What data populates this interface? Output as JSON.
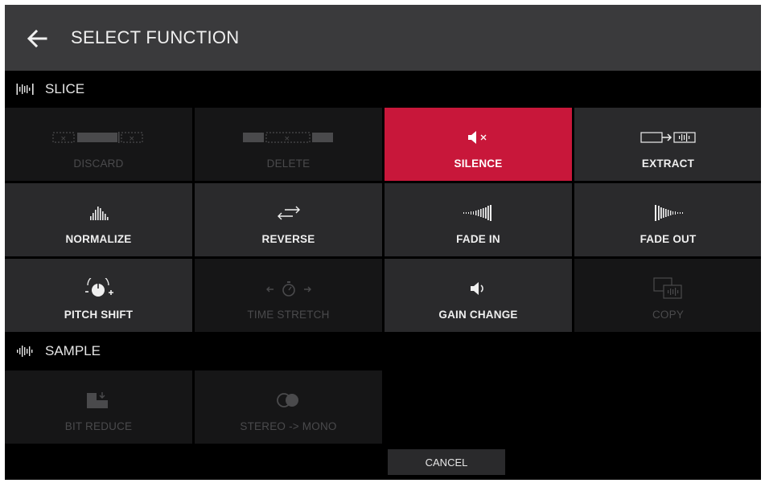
{
  "header": {
    "title": "SELECT FUNCTION",
    "back_icon": "arrow-left-icon"
  },
  "slice": {
    "label": "SLICE",
    "icon": "slice-waveform-icon",
    "tiles": [
      {
        "label": "DISCARD",
        "icon": "discard-icon",
        "state": "disabled"
      },
      {
        "label": "DELETE",
        "icon": "delete-icon",
        "state": "disabled"
      },
      {
        "label": "SILENCE",
        "icon": "speaker-mute-icon",
        "state": "selected"
      },
      {
        "label": "EXTRACT",
        "icon": "extract-icon",
        "state": "enabled"
      },
      {
        "label": "NORMALIZE",
        "icon": "normalize-icon",
        "state": "enabled"
      },
      {
        "label": "REVERSE",
        "icon": "reverse-arrows-icon",
        "state": "enabled"
      },
      {
        "label": "FADE IN",
        "icon": "fade-in-icon",
        "state": "enabled"
      },
      {
        "label": "FADE OUT",
        "icon": "fade-out-icon",
        "state": "enabled"
      },
      {
        "label": "PITCH SHIFT",
        "icon": "pitch-knob-icon",
        "state": "enabled"
      },
      {
        "label": "TIME STRETCH",
        "icon": "stopwatch-icon",
        "state": "disabled"
      },
      {
        "label": "GAIN CHANGE",
        "icon": "speaker-icon",
        "state": "enabled"
      },
      {
        "label": "COPY",
        "icon": "copy-icon",
        "state": "disabled"
      }
    ]
  },
  "sample": {
    "label": "SAMPLE",
    "icon": "sample-waveform-icon",
    "tiles": [
      {
        "label": "BIT REDUCE",
        "icon": "bit-reduce-icon",
        "state": "disabled"
      },
      {
        "label": "STEREO -> MONO",
        "icon": "stereo-mono-icon",
        "state": "disabled"
      }
    ]
  },
  "footer": {
    "cancel_label": "CANCEL"
  },
  "colors": {
    "accent": "#c8173a",
    "header_bg": "#3a3a3c",
    "tile_bg": "#2a2a2c",
    "tile_disabled_bg": "#161617",
    "background": "#000000"
  }
}
